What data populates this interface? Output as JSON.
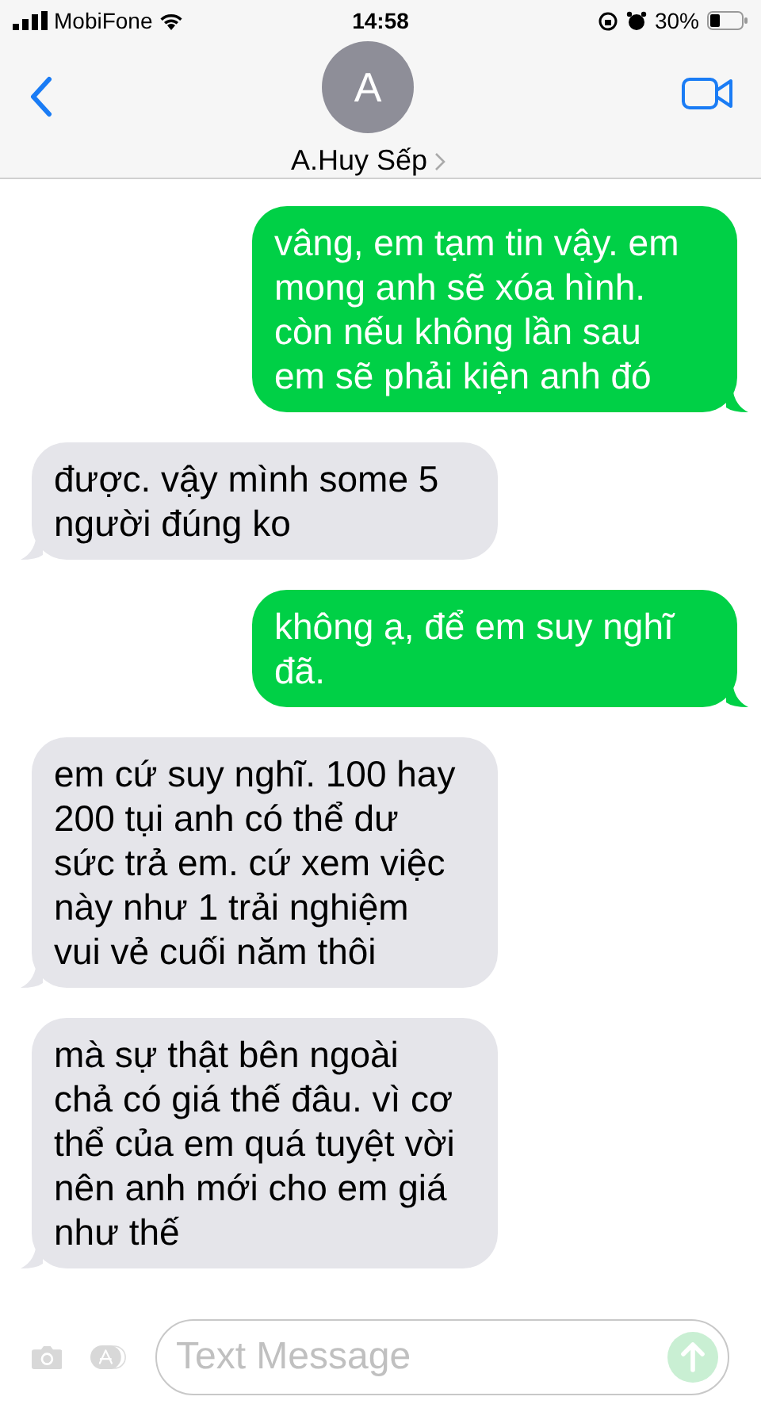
{
  "status_bar": {
    "carrier": "MobiFone",
    "time": "14:58",
    "battery": "30%"
  },
  "header": {
    "avatar_initial": "A",
    "contact_name": "A.Huy Sếp"
  },
  "messages": [
    {
      "kind": "sent",
      "text": "vâng, em tạm tin vậy. em mong anh sẽ xóa hình. còn nếu không lần sau em sẽ phải kiện anh đó"
    },
    {
      "kind": "received",
      "text": "được. vậy mình some 5 người đúng ko"
    },
    {
      "kind": "sent",
      "text": "không ạ, để em suy nghĩ đã."
    },
    {
      "kind": "received",
      "text": "em cứ suy nghĩ. 100 hay 200 tụi anh có thể dư sức trả em. cứ xem việc này như 1 trải nghiệm vui vẻ cuối năm thôi"
    },
    {
      "kind": "received",
      "text": "mà sự thật bên ngoài chả có giá thế đâu. vì cơ thể của em quá tuyệt vời nên anh mới cho em giá như thế"
    }
  ],
  "composer": {
    "placeholder": "Text Message"
  }
}
